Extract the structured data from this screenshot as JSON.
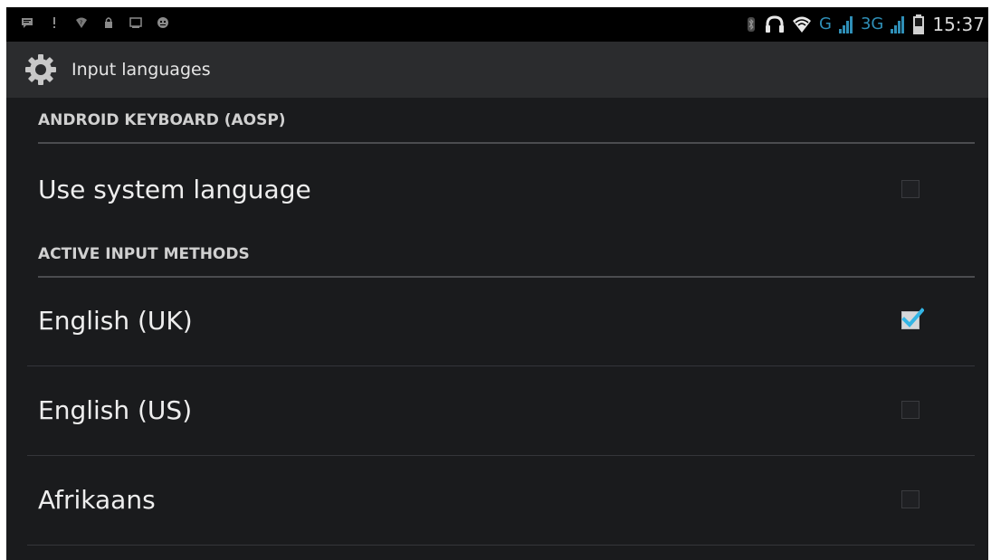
{
  "status_bar": {
    "left_icons": [
      "message-icon",
      "alert-icon",
      "wifi-question-icon",
      "lock-icon",
      "screen-icon",
      "android-icon"
    ],
    "network_g": "G",
    "network_3g": "3G",
    "time": "15:37",
    "accent_color": "#2f8fb7"
  },
  "action_bar": {
    "title": "Input languages",
    "icon": "gear-icon"
  },
  "sections": [
    {
      "header": "ANDROID KEYBOARD (AOSP)",
      "items": [
        {
          "label": "Use system language",
          "checked": false
        }
      ]
    },
    {
      "header": "ACTIVE INPUT METHODS",
      "items": [
        {
          "label": "English (UK)",
          "checked": true
        },
        {
          "label": "English (US)",
          "checked": false
        },
        {
          "label": "Afrikaans",
          "checked": false
        }
      ]
    }
  ],
  "colors": {
    "background": "#1a1b1d",
    "check_accent": "#33b5e5"
  }
}
